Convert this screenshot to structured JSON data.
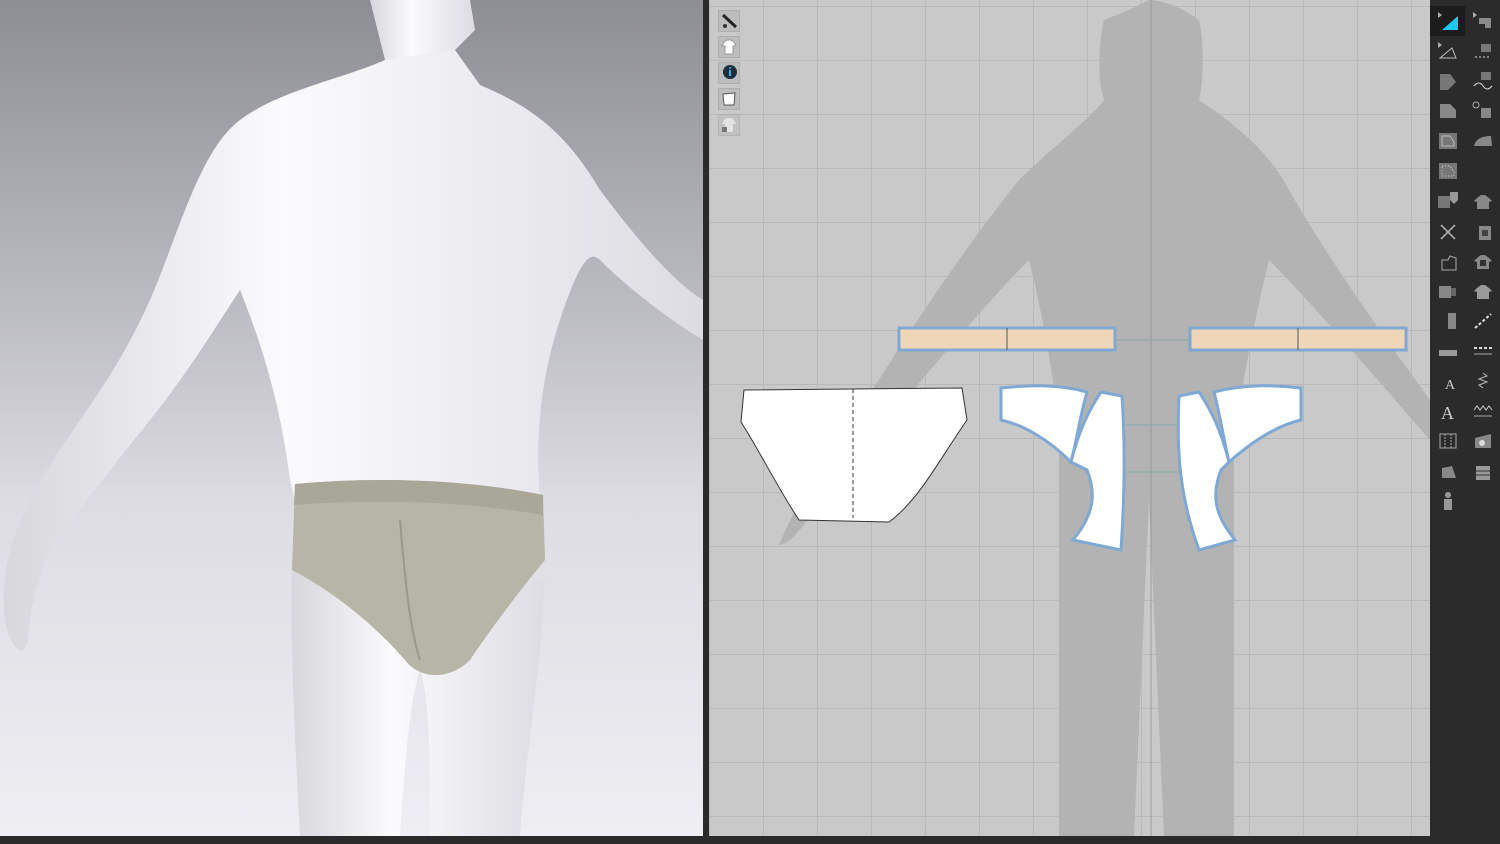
{
  "app": {
    "colors": {
      "viewport_3d_top": "#8d8e93",
      "viewport_3d_bottom": "#eeeef3",
      "viewport_2d_bg": "#c9c9c9",
      "toolbar_bg": "#2b2b2b",
      "garment_fabric": "#b6b4a5",
      "waistband_piece": "#f0d6b8",
      "pattern_piece": "#ffffff",
      "pattern_outline": "#7fa9d4",
      "active_tool_accent": "#1ec8f0"
    }
  },
  "view3d": {
    "icons": [
      "avatar-male",
      "briefs-garment"
    ]
  },
  "view2d": {
    "toolbox": [
      "show-avatar-icon",
      "show-garment-icon",
      "show-info-icon",
      "show-pattern-icon",
      "lock-garment-icon"
    ],
    "pattern_pieces": [
      "waistband-left",
      "waistband-right",
      "back-panel",
      "front-left-panel",
      "front-right-panel"
    ]
  },
  "toolbar": {
    "left_column": [
      "transform-pattern-icon",
      "edit-pattern-icon",
      "polygon-icon",
      "rectangle-icon",
      "internal-polygon-icon",
      "trace-icon",
      "dart-icon",
      "fold-icon",
      "notch-icon",
      "puckering-icon",
      "segment-sewing-icon",
      "tape-icon",
      "text-select-icon",
      "text-icon",
      "grid-icon",
      "pattern-arrange-icon",
      "avatar-icon"
    ],
    "right_column": [
      "edit-sewing-icon",
      "segment-sewing-icon",
      "free-sewing-icon",
      "check-sewing-icon",
      "steam-iron-icon",
      "select-garment-icon",
      "edit-texture-icon",
      "graphic-icon",
      "fabric-icon",
      "topstitch-icon",
      "edit-topstitch-icon",
      "elastic-icon",
      "zigzag-stitch-icon",
      "add-graphic-icon",
      "button-icon"
    ]
  }
}
